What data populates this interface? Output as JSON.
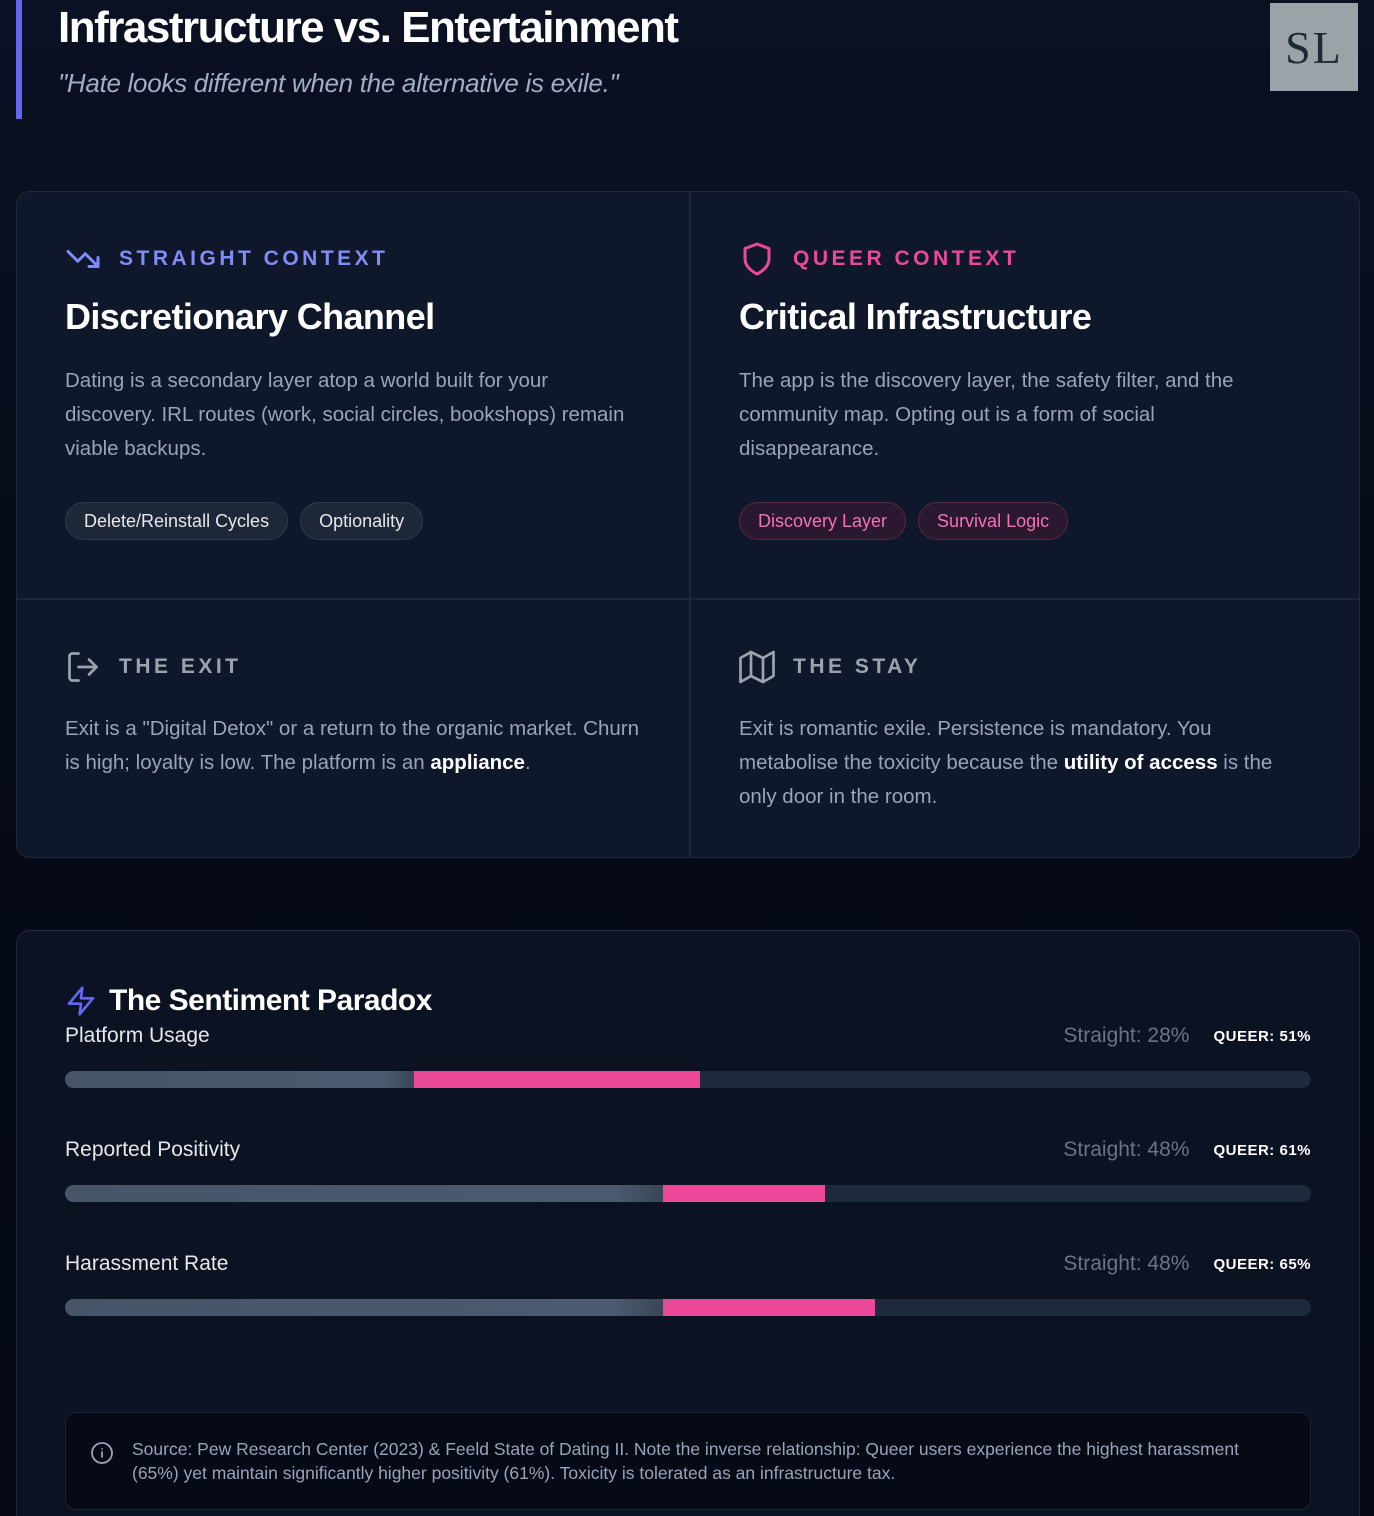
{
  "header": {
    "title": "Infrastructure vs. Entertainment",
    "subtitle": "\"Hate looks different when the alternative is exile.\"",
    "logo_text": "SL"
  },
  "contexts": {
    "straight": {
      "kicker": "STRAIGHT CONTEXT",
      "icon": "trending-down-icon",
      "heading": "Discretionary Channel",
      "body": "Dating is a secondary layer atop a world built for your discovery. IRL routes (work, social circles, bookshops) remain viable backups.",
      "tags": [
        "Delete/Reinstall Cycles",
        "Optionality"
      ]
    },
    "queer": {
      "kicker": "QUEER CONTEXT",
      "icon": "shield-icon",
      "heading": "Critical Infrastructure",
      "body": "The app is the discovery layer, the safety filter, and the community map. Opting out is a form of social disappearance.",
      "tags": [
        "Discovery Layer",
        "Survival Logic"
      ]
    },
    "exit": {
      "kicker": "THE EXIT",
      "icon": "log-out-icon",
      "body_pre": "Exit is a \"Digital Detox\" or a return to the organic market. Churn is high; loyalty is low. The platform is an ",
      "body_bold": "appliance",
      "body_post": "."
    },
    "stay": {
      "kicker": "THE STAY",
      "icon": "map-icon",
      "body_pre": "Exit is romantic exile. Persistence is mandatory. You metabolise the toxicity because the ",
      "body_bold": "utility of access",
      "body_post": " is the only door in the room."
    }
  },
  "sentiment": {
    "title": "The Sentiment Paradox",
    "icon": "zap-icon",
    "metrics": [
      {
        "label": "Platform Usage",
        "straight_label": "Straight: 28%",
        "queer_label": "QUEER: 51%",
        "straight": 28,
        "queer": 51
      },
      {
        "label": "Reported Positivity",
        "straight_label": "Straight: 48%",
        "queer_label": "QUEER: 61%",
        "straight": 48,
        "queer": 61
      },
      {
        "label": "Harassment Rate",
        "straight_label": "Straight: 48%",
        "queer_label": "QUEER: 65%",
        "straight": 48,
        "queer": 65
      }
    ],
    "note": "Source: Pew Research Center (2023) & Feeld State of Dating II. Note the inverse relationship: Queer users experience the highest harassment (65%) yet maintain significantly higher positivity (61%). Toxicity is tolerated as an infrastructure tax.",
    "note_icon": "info-icon"
  },
  "colors": {
    "accent_indigo": "#818cf8",
    "accent_pink": "#ec4899",
    "header_rule": "#6366f1"
  }
}
